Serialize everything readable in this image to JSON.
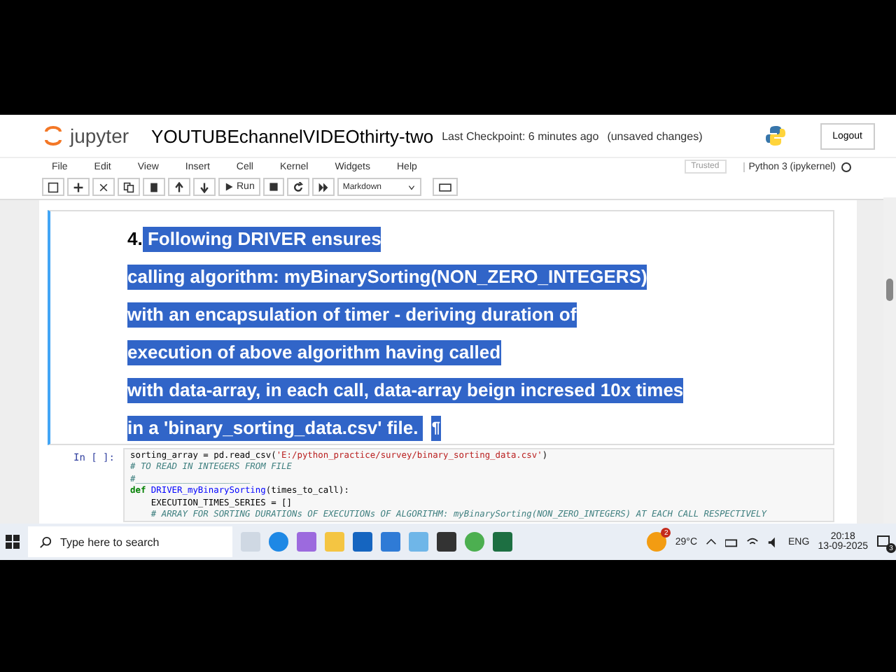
{
  "header": {
    "logo": "jupyter",
    "title": "YOUTUBEchannelVIDEOthirty-two",
    "checkpoint": "Last Checkpoint: 6 minutes ago",
    "status": "(unsaved changes)",
    "logout": "Logout"
  },
  "menu": [
    "File",
    "Edit",
    "View",
    "Insert",
    "Cell",
    "Kernel",
    "Widgets",
    "Help"
  ],
  "trusted": "Trusted",
  "kernel": "Python 3 (ipykernel)",
  "toolbar": {
    "run": "Run",
    "cell_type": "Markdown"
  },
  "markdown_cell": {
    "selected": true,
    "number": "4.",
    "lines": [
      " Following DRIVER ensures",
      "calling algorithm: myBinarySorting(NON_ZERO_INTEGERS)",
      "with an encapsulation of timer - deriving duration of",
      "execution of above algorithm having called",
      "with data-array, in each call, data-array beign incresed 10x times",
      "in a 'binary_sorting_data.csv' file. "
    ],
    "pilcrow": "¶"
  },
  "code_cell": {
    "prompt": "In [ ]:",
    "lines": [
      [
        {
          "text": "sorting_array = pd.read_csv(",
          "kind": "plain"
        },
        {
          "text": "'E:/python_practice/survey/binary_sorting_data.csv'",
          "kind": "string"
        },
        {
          "text": ")",
          "kind": "plain"
        }
      ],
      [
        {
          "text": "# TO READ IN INTEGERS FROM FILE",
          "kind": "comment"
        }
      ],
      [
        {
          "text": "#______________________",
          "kind": "comment"
        }
      ],
      [
        {
          "text": "def ",
          "kind": "keyword"
        },
        {
          "text": "DRIVER_myBinarySorting",
          "kind": "function"
        },
        {
          "text": "(times_to_call):",
          "kind": "plain"
        }
      ],
      [
        {
          "text": "    EXECUTION_TIMES_SERIES = []",
          "kind": "plain"
        }
      ],
      [
        {
          "text": "    # ARRAY FOR SORTING DURATIONs OF EXECUTIONs OF ALGORITHM: myBinarySorting(NON_ZERO_INTEGERS) AT EACH CALL RESPECTIVELY",
          "kind": "comment"
        }
      ]
    ]
  },
  "taskbar": {
    "search": "Type here to search",
    "weather_badge": "2",
    "temperature": "29°C",
    "language": "ENG",
    "time": "20:18",
    "date": "13-09-2025",
    "notifications": "3"
  }
}
